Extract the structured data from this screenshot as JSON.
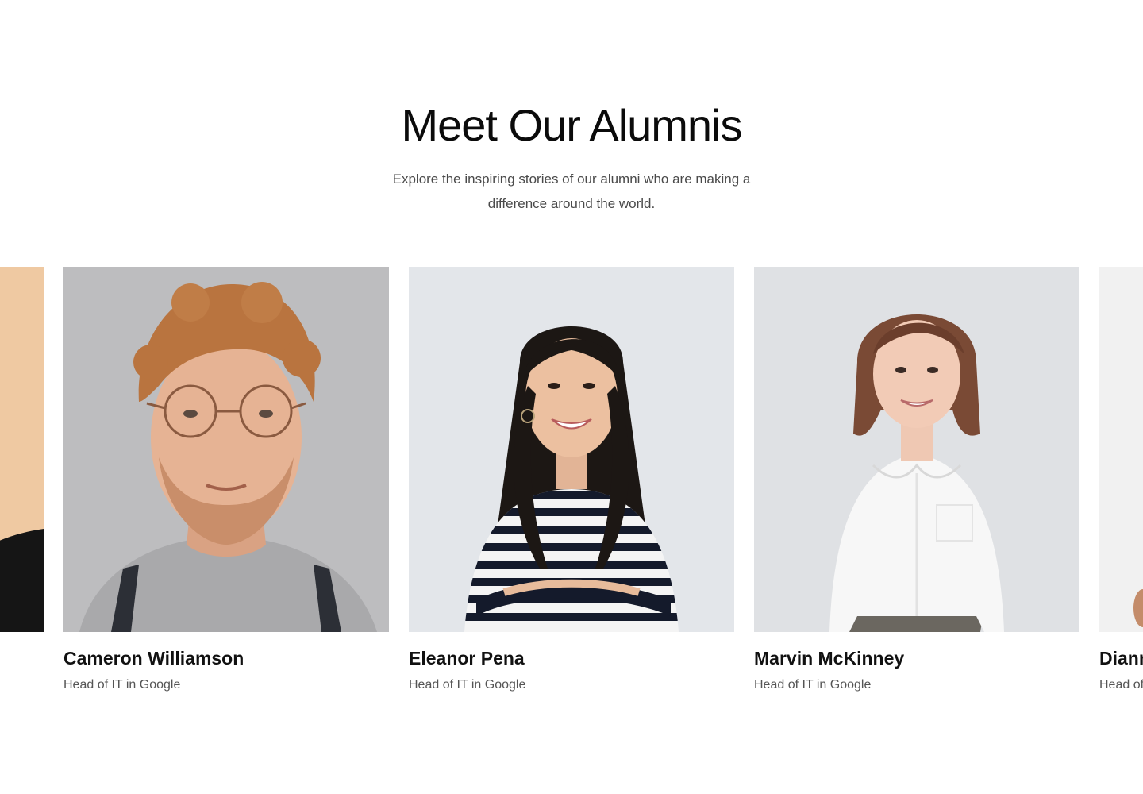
{
  "section": {
    "title": "Meet Our Alumnis",
    "subtitle": "Explore the inspiring stories of our alumni who are making a difference around the world."
  },
  "alumni": [
    {
      "name": "",
      "role": "",
      "photo_bg": "#efc9a2"
    },
    {
      "name": "Cameron Williamson",
      "role": "Head of IT in Google",
      "photo_bg": "#b9b9bb"
    },
    {
      "name": "Eleanor Pena",
      "role": "Head of IT in Google",
      "photo_bg": "#e3e6ea"
    },
    {
      "name": "Marvin McKinney",
      "role": "Head of IT in Google",
      "photo_bg": "#dfe1e4"
    },
    {
      "name": "Dianne",
      "role": "Head of IT in Google",
      "photo_bg": "#f2f2f2"
    }
  ]
}
